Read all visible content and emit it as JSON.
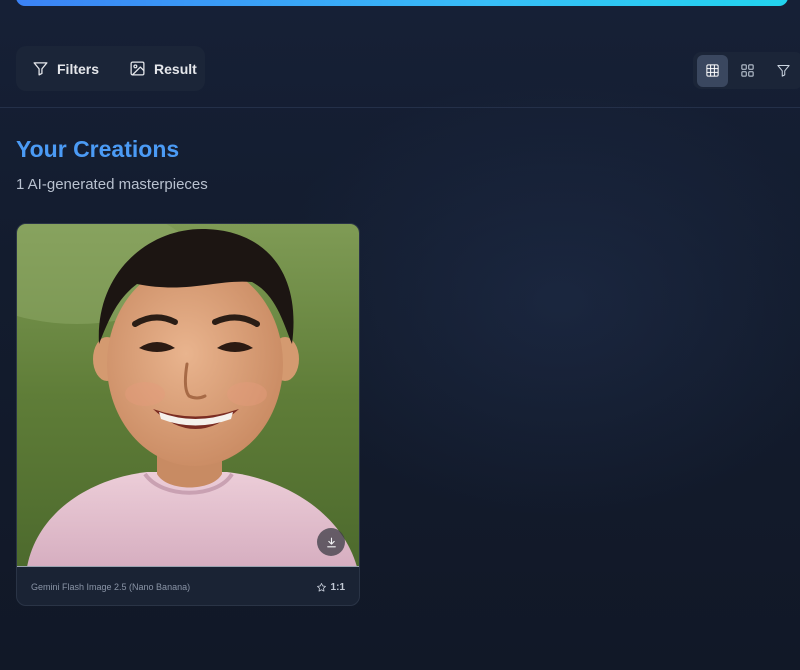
{
  "toolbar": {
    "filters_label": "Filters",
    "result_label": "Result",
    "view_options": [
      {
        "name": "grid-dense",
        "icon": "grid-3x3-icon",
        "active": true
      },
      {
        "name": "grid-large",
        "icon": "grid-2x2-icon",
        "active": false
      },
      {
        "name": "filter",
        "icon": "filter-icon",
        "active": false
      }
    ]
  },
  "gallery": {
    "title": "Your Creations",
    "subtitle": "1 AI-generated masterpieces",
    "items": [
      {
        "model": "Gemini Flash Image 2.5 (Nano Banana)",
        "aspect_ratio": "1:1",
        "image_description": "smiling-child-portrait"
      }
    ]
  },
  "colors": {
    "accent": "#4b9bf5",
    "background": "#121a2b",
    "panel": "#1b2538"
  }
}
